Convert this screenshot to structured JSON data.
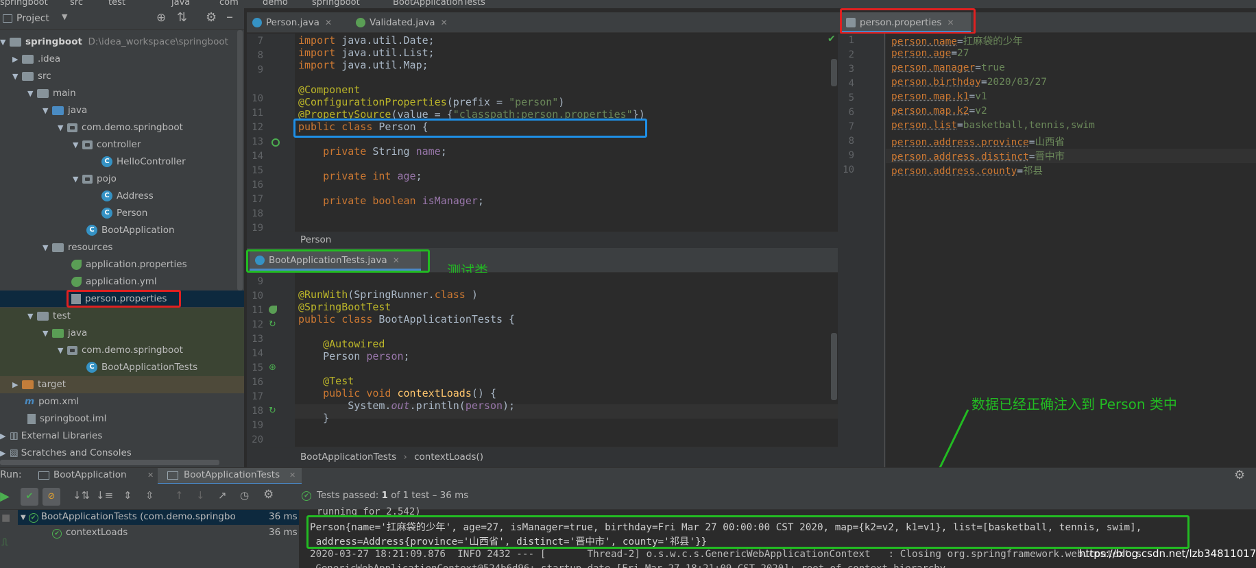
{
  "navbar": {
    "crumbs": [
      "springboot",
      "src",
      "test",
      "java",
      "com",
      "demo",
      "springboot",
      "BootApplicationTests"
    ]
  },
  "project": {
    "title": "Project",
    "root_name": "springboot",
    "root_path": "D:\\idea_workspace\\springboot",
    "items": [
      {
        "label": ".idea"
      },
      {
        "label": "src"
      },
      {
        "label": "main"
      },
      {
        "label": "java"
      },
      {
        "label": "com.demo.springboot"
      },
      {
        "label": "controller"
      },
      {
        "label": "HelloController"
      },
      {
        "label": "pojo"
      },
      {
        "label": "Address"
      },
      {
        "label": "Person"
      },
      {
        "label": "BootApplication"
      },
      {
        "label": "resources"
      },
      {
        "label": "application.properties"
      },
      {
        "label": "application.yml"
      },
      {
        "label": "person.properties"
      },
      {
        "label": "test"
      },
      {
        "label": "java"
      },
      {
        "label": "com.demo.springboot"
      },
      {
        "label": "BootApplicationTests"
      },
      {
        "label": "target"
      },
      {
        "label": "pom.xml"
      },
      {
        "label": "springboot.iml"
      },
      {
        "label": "External Libraries"
      },
      {
        "label": "Scratches and Consoles"
      }
    ]
  },
  "editor_top": {
    "tabs": [
      {
        "label": "Person.java"
      },
      {
        "label": "Validated.java"
      }
    ],
    "lines": [
      "7",
      "8",
      "9",
      "10",
      "11",
      "12",
      "13",
      "14",
      "15",
      "16",
      "17",
      "18",
      "19"
    ],
    "breadcrumb": "Person"
  },
  "editor_bottom": {
    "tab": "BootApplicationTests.java",
    "lines": [
      "9",
      "10",
      "11",
      "12",
      "13",
      "14",
      "15",
      "16",
      "17",
      "18",
      "19",
      "20"
    ],
    "breadcrumb_class": "BootApplicationTests",
    "breadcrumb_sep": "›",
    "breadcrumb_method": "contextLoads()"
  },
  "properties_editor": {
    "tab": "person.properties",
    "lines": [
      "1",
      "2",
      "3",
      "4",
      "5",
      "6",
      "7",
      "8",
      "9",
      "10"
    ],
    "entries": [
      {
        "key": "person.name",
        "value": "扛麻袋的少年"
      },
      {
        "key": "person.age",
        "value": "27"
      },
      {
        "key": "person.manager",
        "value": "true"
      },
      {
        "key": "person.birthday",
        "value": "2020/03/27"
      },
      {
        "key": "person.map.k1",
        "value": "v1"
      },
      {
        "key": "person.map.k2",
        "value": "v2"
      },
      {
        "key": "person.list",
        "value": "basketball,tennis,swim"
      },
      {
        "key": "person.address.province",
        "value": "山西省"
      },
      {
        "key": "person.address.distinct",
        "value": "晋中市"
      },
      {
        "key": "person.address.county",
        "value": "祁县"
      }
    ],
    "eq": "="
  },
  "annotations": {
    "test_class_note": "测试类",
    "injected_note": "数据已经正确注入到 Person 类中"
  },
  "run": {
    "label": "Run:",
    "tabs": [
      {
        "label": "BootApplication"
      },
      {
        "label": "BootApplicationTests"
      }
    ],
    "status_prefix": "Tests passed: ",
    "status_count": "1",
    "status_suffix": " of 1 test – 36 ms",
    "tree": [
      {
        "label": "BootApplicationTests (com.demo.springbo",
        "time": "36 ms"
      },
      {
        "label": "contextLoads",
        "time": "36 ms"
      }
    ],
    "console": [
      "running for 2.542)",
      "Person{name='扛麻袋的少年', age=27, isManager=true, birthday=Fri Mar 27 00:00:00 CST 2020, map={k2=v2, k1=v1}, list=[basketball, tennis, swim],",
      " address=Address{province='山西省', distinct='晋中市', county='祁县'}}",
      "2020-03-27 18:21:09.876  INFO 2432 --- [       Thread-2] o.s.w.c.s.GenericWebApplicationContext   : Closing org.springframework.web.context.s"
    ],
    "watermark": "https://blog.csdn.net/lzb348110175"
  }
}
